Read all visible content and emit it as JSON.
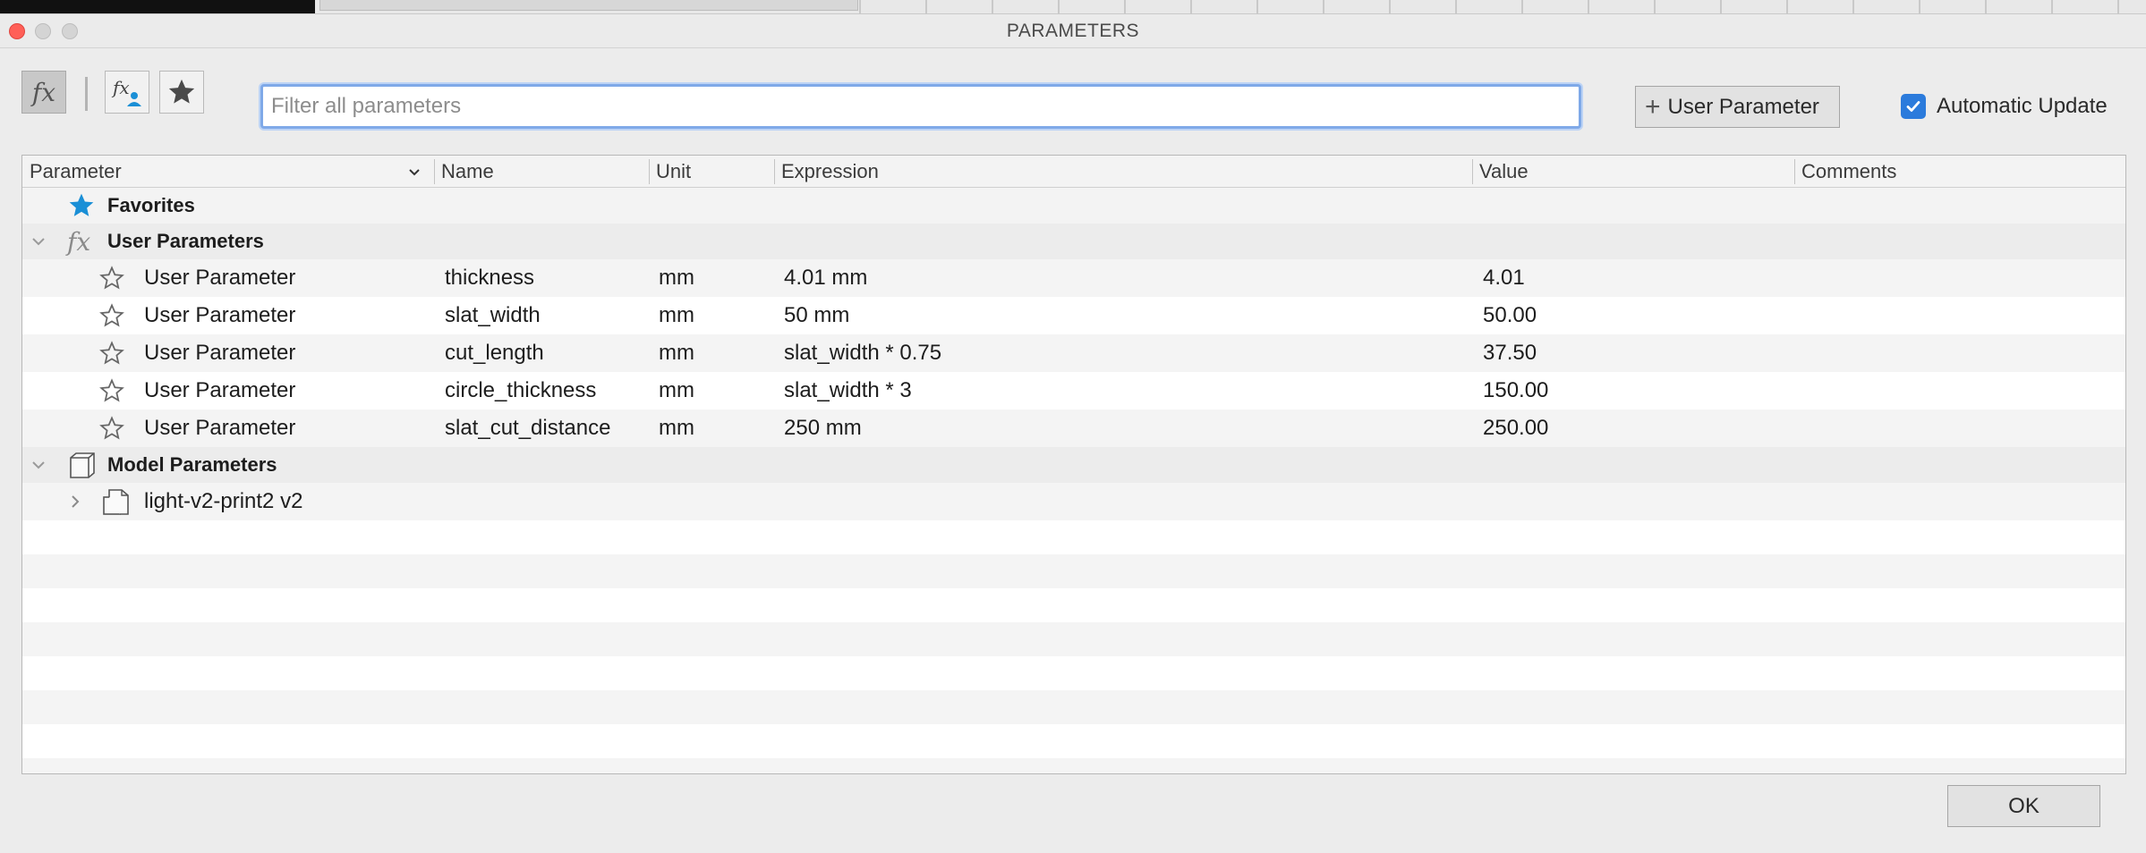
{
  "window": {
    "title": "PARAMETERS"
  },
  "toolbar": {
    "filter_placeholder": "Filter all parameters",
    "add_user_parameter_label": "User Parameter",
    "automatic_update_label": "Automatic Update",
    "automatic_update_checked": true
  },
  "table": {
    "columns": [
      "Parameter",
      "Name",
      "Unit",
      "Expression",
      "Value",
      "Comments"
    ],
    "groups": {
      "favorites": "Favorites",
      "user_parameters": "User Parameters",
      "model_parameters": "Model Parameters"
    },
    "user_rows": [
      {
        "parameter": "User Parameter",
        "name": "thickness",
        "unit": "mm",
        "expression": "4.01 mm",
        "value": "4.01",
        "comments": ""
      },
      {
        "parameter": "User Parameter",
        "name": "slat_width",
        "unit": "mm",
        "expression": "50 mm",
        "value": "50.00",
        "comments": ""
      },
      {
        "parameter": "User Parameter",
        "name": "cut_length",
        "unit": "mm",
        "expression": "slat_width * 0.75",
        "value": "37.50",
        "comments": ""
      },
      {
        "parameter": "User Parameter",
        "name": "circle_thickness",
        "unit": "mm",
        "expression": "slat_width * 3",
        "value": "150.00",
        "comments": ""
      },
      {
        "parameter": "User Parameter",
        "name": "slat_cut_distance",
        "unit": "mm",
        "expression": "250 mm",
        "value": "250.00",
        "comments": ""
      }
    ],
    "model_items": [
      {
        "label": "light-v2-print2 v2"
      }
    ]
  },
  "footer": {
    "ok_label": "OK"
  },
  "colors": {
    "accent": "#2b7bdc",
    "favorite_star": "#1a8fd6",
    "close": "#ff5f57"
  }
}
